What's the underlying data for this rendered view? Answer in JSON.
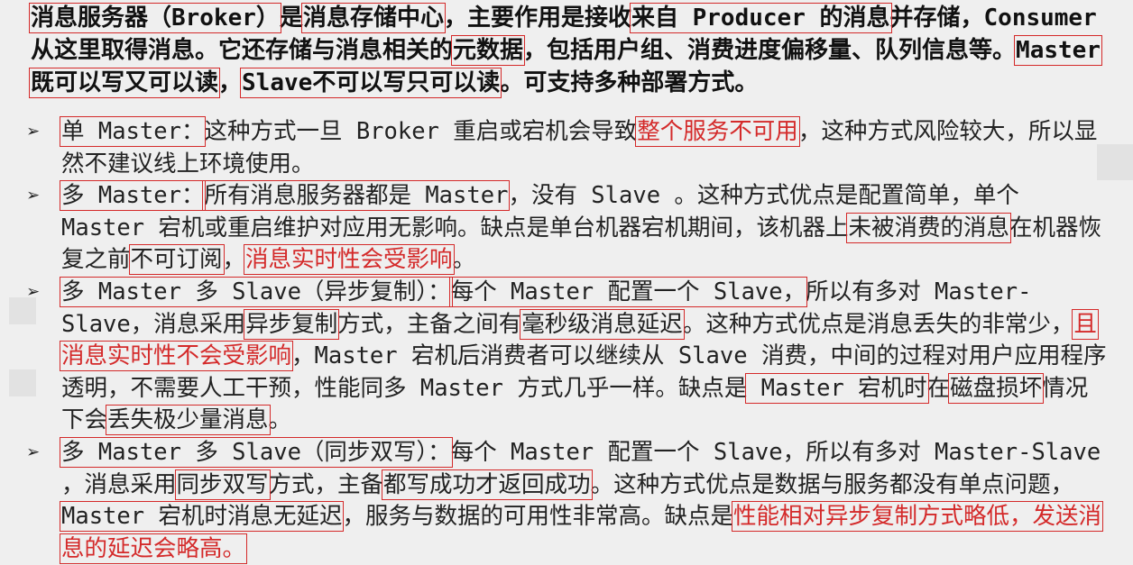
{
  "intro": {
    "p1": "消息服务器（Broker）",
    "p2": "是",
    "p3": "消息存储中心",
    "p4": "，主要作用是接收",
    "p5": "来自 Producer 的消息",
    "p6": "并存储，Consumer 从这里取得消息。它还存储与消息相关的",
    "p7": "元数据",
    "p8": "，包括用户组、消费进度偏移量、队列信息等。",
    "p9": "Master 既可以写又可以读",
    "p10": "，",
    "p11": "Slave不可以写只可以读",
    "p12": "。可支持多种部署方式。"
  },
  "bullets": [
    {
      "mark": "➢",
      "a": "单 Master：",
      "b": "这种方式一旦 Broker 重启或宕机会导致",
      "c": "整个服务不可用",
      "d": "，这种方式风险较大，所以显然不建议线上环境使用。"
    },
    {
      "mark": "➢",
      "a": "多 Master：",
      "b": "所有消息服务器都是 Master",
      "c": "，没有 Slave 。这种方式优点是配置简单，单个 Master 宕机或重启维护对应用无影响。缺点是单台机器宕机期间，该机器上",
      "d": "未被消费的消息",
      "e": "在机器恢复之前",
      "f": "不可订阅",
      "g": "，",
      "h": "消息实时性会受影响",
      "i": "。"
    },
    {
      "mark": "➢",
      "a": "多 Master 多 Slave（异步复制）：",
      "b": "每个 Master 配置一个 Slave，",
      "c": "所以有多对 Master-Slave，消息采用",
      "d": "异步复制",
      "e": "方式，主备之间有",
      "f": "毫秒级消息延迟",
      "g": "。这种方式优点是消息丢失的非常少，",
      "h": "且消息实时性不会受影响",
      "i": "，Master 宕机后消费者可以继续从 Slave 消费，中间的过程对用户应用程序透明，不需要人工干预，性能同多 Master 方式几乎一样。缺点是",
      "j": " Master 宕机时",
      "k": "在",
      "l": "磁盘损坏",
      "m": "情况下会",
      "n": "丢失极少量消息",
      "o": "。"
    },
    {
      "mark": "➢",
      "a": "多 Master 多 Slave（同步双写）：",
      "b": "每个 Master 配置一个 Slave，所以有多对 Master-Slave ，消息采用",
      "c": "同步双写",
      "d": "方式，主备",
      "e": "都写成功才返回成功",
      "f": "。这种方式优点是数据与服务都没有单点问题，",
      "g": "Master 宕机时消息无延迟",
      "h": "，服务与数据的可用性非常高。缺点是",
      "i": "性能相对异步复制方式略低，发送消息的延迟会略高。"
    }
  ]
}
